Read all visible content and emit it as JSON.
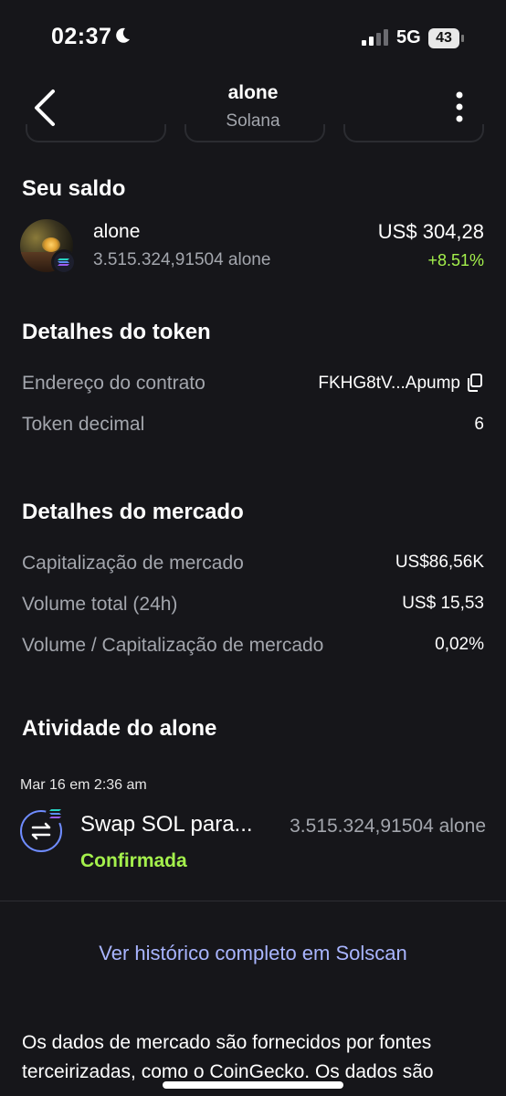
{
  "status_bar": {
    "time": "02:37",
    "network": "5G",
    "battery": "43",
    "icons": [
      "moon-icon",
      "signal-icon",
      "battery-icon"
    ]
  },
  "header": {
    "title": "alone",
    "subtitle": "Solana",
    "icons": [
      "back-arrow-icon",
      "more-vertical-icon"
    ]
  },
  "balance": {
    "heading": "Seu saldo",
    "token_name": "alone",
    "token_amount": "3.515.324,91504 alone",
    "fiat_value": "US$ 304,28",
    "change": "+8.51%",
    "change_color": "#a4f04c"
  },
  "token_details": {
    "heading": "Detalhes do token",
    "rows": [
      {
        "label": "Endereço do contrato",
        "value": "FKHG8tV...Apump"
      },
      {
        "label": "Token decimal",
        "value": "6"
      }
    ]
  },
  "market_details": {
    "heading": "Detalhes do mercado",
    "rows": [
      {
        "label": "Capitalização de mercado",
        "value": "US$86,56K"
      },
      {
        "label": "Volume total (24h)",
        "value": "US$ 15,53"
      },
      {
        "label": "Volume / Capitalização de mercado",
        "value": "0,02%"
      }
    ]
  },
  "activity": {
    "heading": "Atividade do alone",
    "date": "Mar 16 em 2:36 am",
    "tx_title": "Swap SOL para...",
    "tx_amount": "3.515.324,91504 alone",
    "tx_status": "Confirmada",
    "status_color": "#a4f04c"
  },
  "link_text": "Ver histórico completo em Solscan",
  "footer_text": "Os dados de mercado são fornecidos por fontes terceirizadas, como o CoinGecko. Os dados são",
  "colors": {
    "background": "#16161a",
    "muted_text": "#a3a6ad",
    "link": "#a9b5ff",
    "accent_green": "#a4f04c"
  }
}
